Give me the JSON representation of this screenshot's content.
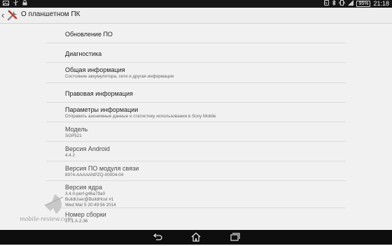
{
  "status_bar": {
    "time": "21:18",
    "battery": "95%",
    "left_icons": [
      "picture-icon",
      "usb-icon",
      "lock-icon"
    ],
    "right_icons": [
      "nfc-icon",
      "bluetooth-icon",
      "vibrate-icon",
      "signal-icon",
      "battery-icon"
    ]
  },
  "action_bar": {
    "title": "О планшетном ПК"
  },
  "list": [
    {
      "title": "Обновление ПО"
    },
    {
      "title": "Диагностика"
    },
    {
      "title": "Общая информация",
      "subtitle": "Состояние аккумулятора, сети и другая информация"
    },
    {
      "title": "Правовая информация"
    },
    {
      "title": "Параметры информации",
      "subtitle": "Отправить анонимные данные и статистику использования в Sony Mobile"
    },
    {
      "title": "Модель",
      "value": "SGP521"
    },
    {
      "title": "Версия Android",
      "value": "4.4.2"
    },
    {
      "title": "Версия ПО модуля связи",
      "value": "8974-AAAAANPZQ-00004-04"
    },
    {
      "title": "Версия ядра",
      "value": "3.4.0-perf-g46a79a0",
      "value2": "BuildUser@BuildHost #1",
      "value3": "Wed Mar 5 20:49:56 2014"
    },
    {
      "title": "Номер сборки",
      "value": "17.1.A.2.36"
    }
  ],
  "nav_bar": {
    "buttons": [
      "back-icon",
      "home-icon",
      "recent-apps-icon"
    ]
  },
  "watermark": {
    "text": "mobile-review.com"
  },
  "colors": {
    "background": "#f1f1f1",
    "status_bar": "#151515",
    "nav_bar": "#0e0e0e",
    "divider": "#dadada"
  }
}
